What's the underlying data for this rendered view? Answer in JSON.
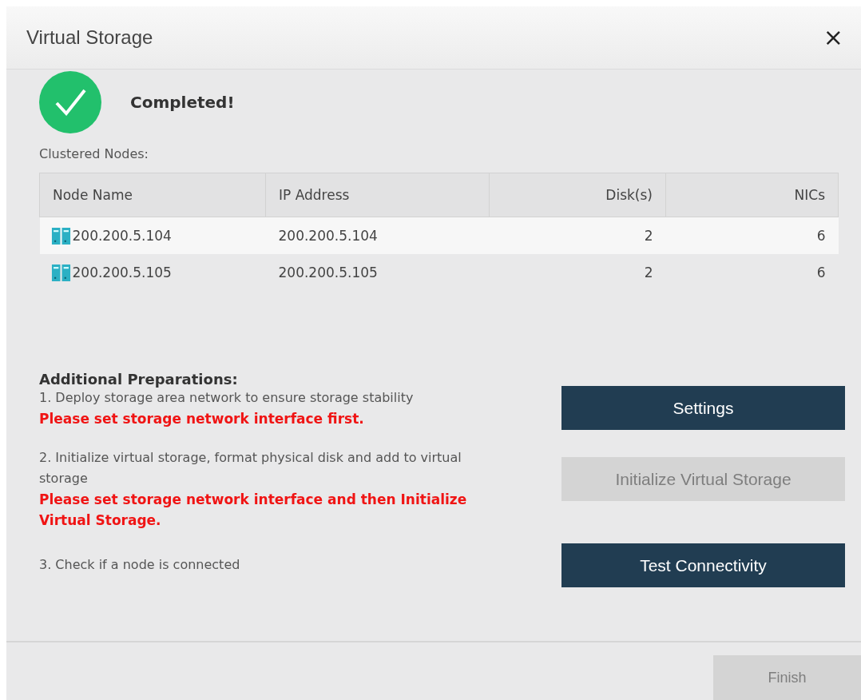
{
  "window": {
    "title": "Virtual Storage",
    "close": "×"
  },
  "status": {
    "kind": "success",
    "message": "Completed!"
  },
  "nodes_label": "Clustered Nodes:",
  "table": {
    "columns": [
      {
        "label": "Node Name",
        "kind": "text"
      },
      {
        "label": "IP Address",
        "kind": "text"
      },
      {
        "label": "Disk(s)",
        "kind": "number"
      },
      {
        "label": "NICs",
        "kind": "number"
      }
    ],
    "rows": [
      {
        "selected": true,
        "cells": [
          "200.200.5.104",
          "200.200.5.104",
          "2",
          "6"
        ]
      },
      {
        "selected": false,
        "cells": [
          "200.200.5.105",
          "200.200.5.105",
          "2",
          "6"
        ]
      }
    ]
  },
  "preparations": {
    "title": "Additional Preparations:",
    "steps": [
      {
        "text": "1. Deploy storage area network to ensure storage stability",
        "warning": "Please set storage network interface first.",
        "button": {
          "label": "Settings",
          "disabled": false
        }
      },
      {
        "text": "2. Initialize virtual storage, format physical disk and add to virtual storage",
        "warning": "Please set storage network interface and then Initialize Virtual Storage.",
        "button": {
          "label": "Initialize Virtual Storage",
          "disabled": true
        }
      },
      {
        "text": "3. Check if a node is connected",
        "button": {
          "label": "Test Connectivity",
          "disabled": false
        }
      }
    ]
  },
  "footer": {
    "button": {
      "label": "Finish",
      "disabled": true
    }
  }
}
